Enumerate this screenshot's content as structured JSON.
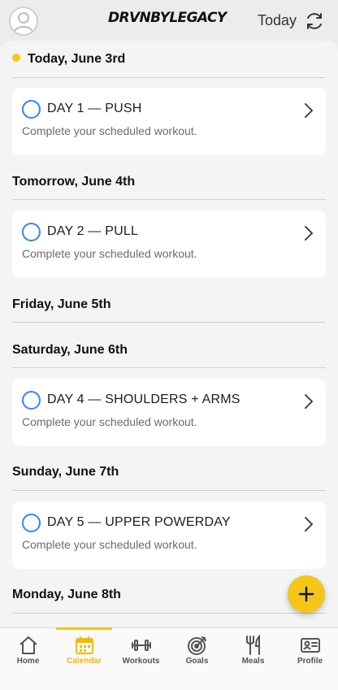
{
  "header": {
    "logo_text": "DRVNBYLEGACY",
    "today_label": "Today",
    "refresh_icon": "refresh-icon",
    "avatar_icon": "user-avatar-icon"
  },
  "days": [
    {
      "label": "Today, June 3rd",
      "is_today": true
    },
    {
      "label": "Tomorrow, June 4th"
    },
    {
      "label": "Friday, June 5th"
    },
    {
      "label": "Saturday, June 6th"
    },
    {
      "label": "Sunday, June 7th"
    },
    {
      "label": "Monday, June 8th"
    }
  ],
  "workouts": [
    {
      "title": "DAY 1 — PUSH",
      "subtitle": "Complete your scheduled workout."
    },
    {
      "title": "DAY 2 — PULL",
      "subtitle": "Complete your scheduled workout."
    },
    {
      "title": "DAY 4 — SHOULDERS + ARMS",
      "subtitle": "Complete your scheduled workout."
    },
    {
      "title": "DAY 5 — UPPER POWERDAY",
      "subtitle": "Complete your scheduled workout."
    }
  ],
  "fab": {
    "icon": "plus-icon"
  },
  "nav": {
    "items": [
      {
        "label": "Home",
        "icon": "home-icon"
      },
      {
        "label": "Calendar",
        "icon": "calendar-icon",
        "active": true
      },
      {
        "label": "Workouts",
        "icon": "dumbbell-icon"
      },
      {
        "label": "Goals",
        "icon": "target-icon"
      },
      {
        "label": "Meals",
        "icon": "fork-knife-icon"
      },
      {
        "label": "Profile",
        "icon": "id-card-icon"
      }
    ]
  },
  "colors": {
    "accent": "#f5c518",
    "checkbox_blue": "#3b82f6",
    "background": "#f4f4f4"
  }
}
